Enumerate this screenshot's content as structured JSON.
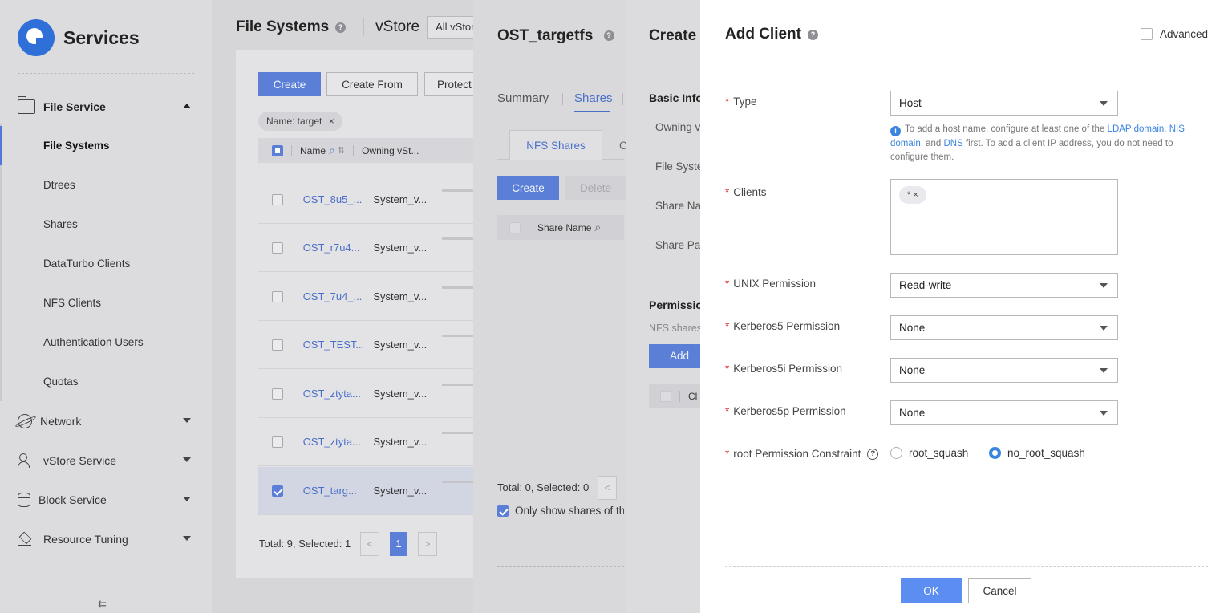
{
  "sidebar": {
    "title": "Services",
    "groups": [
      {
        "label": "File Service",
        "icon": "folder-icon"
      },
      {
        "label": "Network",
        "icon": "planet-icon"
      },
      {
        "label": "vStore Service",
        "icon": "users-icon"
      },
      {
        "label": "Block Service",
        "icon": "database-icon"
      },
      {
        "label": "Resource Tuning",
        "icon": "layers-icon"
      }
    ],
    "file_service_items": [
      "File Systems",
      "Dtrees",
      "Shares",
      "DataTurbo Clients",
      "NFS Clients",
      "Authentication Users",
      "Quotas"
    ],
    "collapse_icon": "⇇"
  },
  "file_systems": {
    "title": "File Systems",
    "vstore_label": "vStore",
    "vstore_value": "All vStores",
    "buttons": {
      "create": "Create",
      "create_from": "Create From",
      "protect": "Protect"
    },
    "filter_tag": "Name: target",
    "filter_tag_close": "×",
    "columns": {
      "name": "Name",
      "owning_vstore": "Owning vSt..."
    },
    "rows": [
      {
        "name": "OST_8u5_...",
        "vstore": "System_v...",
        "selected": false
      },
      {
        "name": "OST_r7u4...",
        "vstore": "System_v...",
        "selected": false
      },
      {
        "name": "OST_7u4_...",
        "vstore": "System_v...",
        "selected": false
      },
      {
        "name": "OST_TEST...",
        "vstore": "System_v...",
        "selected": false
      },
      {
        "name": "OST_ztyta...",
        "vstore": "System_v...",
        "selected": false
      },
      {
        "name": "OST_ztyta...",
        "vstore": "System_v...",
        "selected": false
      },
      {
        "name": "OST_targ...",
        "vstore": "System_v...",
        "selected": true
      }
    ],
    "total": "Total: 9, Selected: 1",
    "page_prev": "<",
    "page_current": "1",
    "page_next": ">"
  },
  "targetfs": {
    "title": "OST_targetfs",
    "tabs": [
      "Summary",
      "Shares"
    ],
    "subtabs": [
      "NFS Shares",
      "C"
    ],
    "create": "Create",
    "delete": "Delete",
    "column_share_name": "Share Name",
    "total": "Total: 0, Selected: 0",
    "page_prev": "<",
    "only_show": "Only show shares of th"
  },
  "create_panel": {
    "title": "Create",
    "basic_info": "Basic Info",
    "labels": [
      "Owning v",
      "File Syste",
      "Share Na",
      "Share Pat"
    ],
    "permission": "Permissio",
    "nfs_shares": "NFS shares",
    "add": "Add",
    "col": "Cl"
  },
  "dialog": {
    "title": "Add Client",
    "advanced": "Advanced",
    "type_label": "Type",
    "type_value": "Host",
    "hint_pre": "To add a host name, configure at least one of the",
    "hint_ldap": "LDAP domain",
    "hint_sep1": ",",
    "hint_nis": "NIS domain",
    "hint_and": ", and",
    "hint_dns": "DNS",
    "hint_post": "first. To add a client IP address, you do not need to configure them.",
    "info_icon": "i",
    "clients_label": "Clients",
    "clients_chip": "* ×",
    "unix_label": "UNIX Permission",
    "unix_value": "Read-write",
    "krb5_label": "Kerberos5 Permission",
    "krb5_value": "None",
    "krb5i_label": "Kerberos5i Permission",
    "krb5i_value": "None",
    "krb5p_label": "Kerberos5p Permission",
    "krb5p_value": "None",
    "root_label": "root Permission Constraint",
    "root_options": [
      "root_squash",
      "no_root_squash"
    ],
    "root_selected": "no_root_squash",
    "ok": "OK",
    "cancel": "Cancel"
  },
  "colors": {
    "primary": "#5b7fd6",
    "link": "#3b84e0",
    "required": "#e03c3c"
  }
}
